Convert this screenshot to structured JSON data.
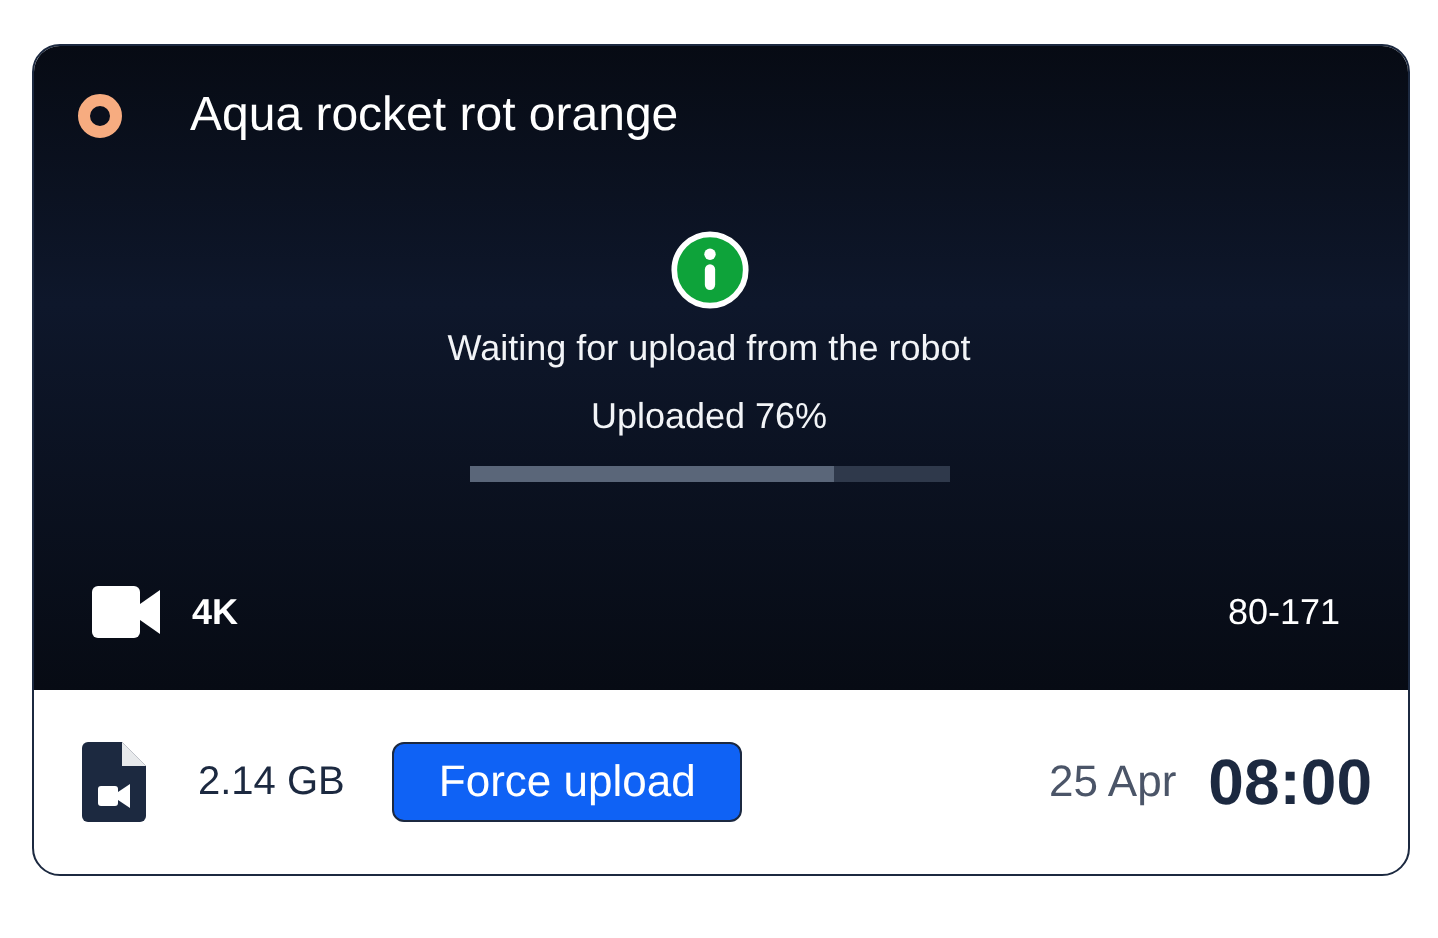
{
  "card": {
    "title": "Aqua rocket rot orange",
    "status": {
      "color": "#f7ac80"
    },
    "upload": {
      "message": "Waiting for upload from the robot",
      "progress_text": "Uploaded 76%",
      "level": 0.76
    },
    "resolution": "4K",
    "code": "80-171"
  },
  "footer": {
    "size": "2.14 GB",
    "button": "Force upload",
    "date": "25 Apr",
    "time": "08:00"
  }
}
